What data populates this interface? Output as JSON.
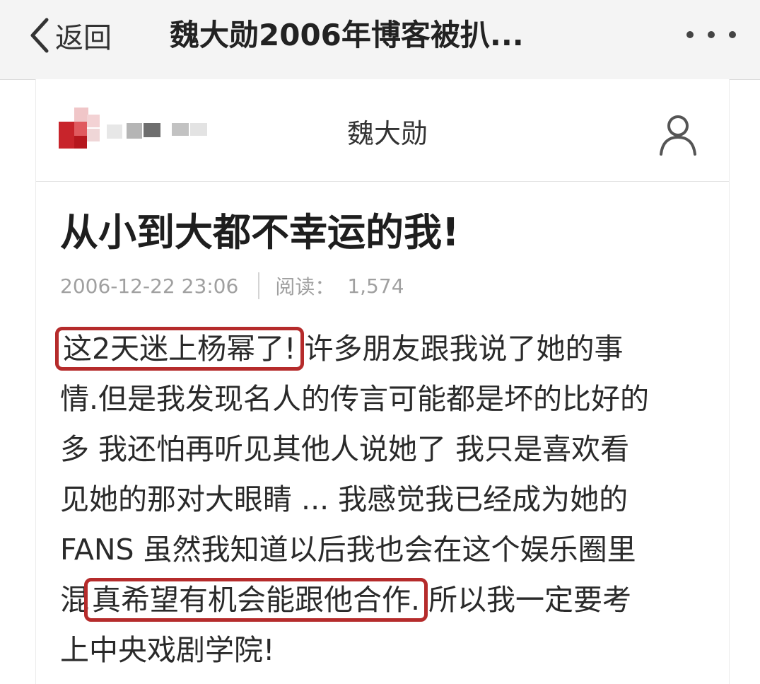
{
  "nav": {
    "back_label": "返回",
    "title": "魏大勋2006年博客被扒...",
    "more_icon": "more-dots-icon"
  },
  "blog": {
    "author_name": "魏大勋",
    "user_icon": "user-profile-icon",
    "logo": "pixelated-logo"
  },
  "post": {
    "title": "从小到大都不幸运的我!",
    "date": "2006-12-22 23:06",
    "reads_label": "阅读：",
    "reads_count": "1,574",
    "highlight_color": "#b52b2b",
    "lines": [
      {
        "highlight": "这2天迷上杨幂了!",
        "text": "许多朋友跟我说了她的事"
      },
      {
        "text": "情.但是我发现名人的传言可能都是坏的比好的"
      },
      {
        "text": "多 我还怕再听见其他人说她了 我只是喜欢看"
      },
      {
        "text": "见她的那对大眼睛 ... 我感觉我已经成为她的"
      },
      {
        "text": "FANS 虽然我知道以后我也会在这个娱乐圈里"
      },
      {
        "pre": "混",
        "highlight": "真希望有机会能跟他合作.",
        "text": "所以我一定要考"
      },
      {
        "text": "上中央戏剧学院!"
      }
    ]
  }
}
